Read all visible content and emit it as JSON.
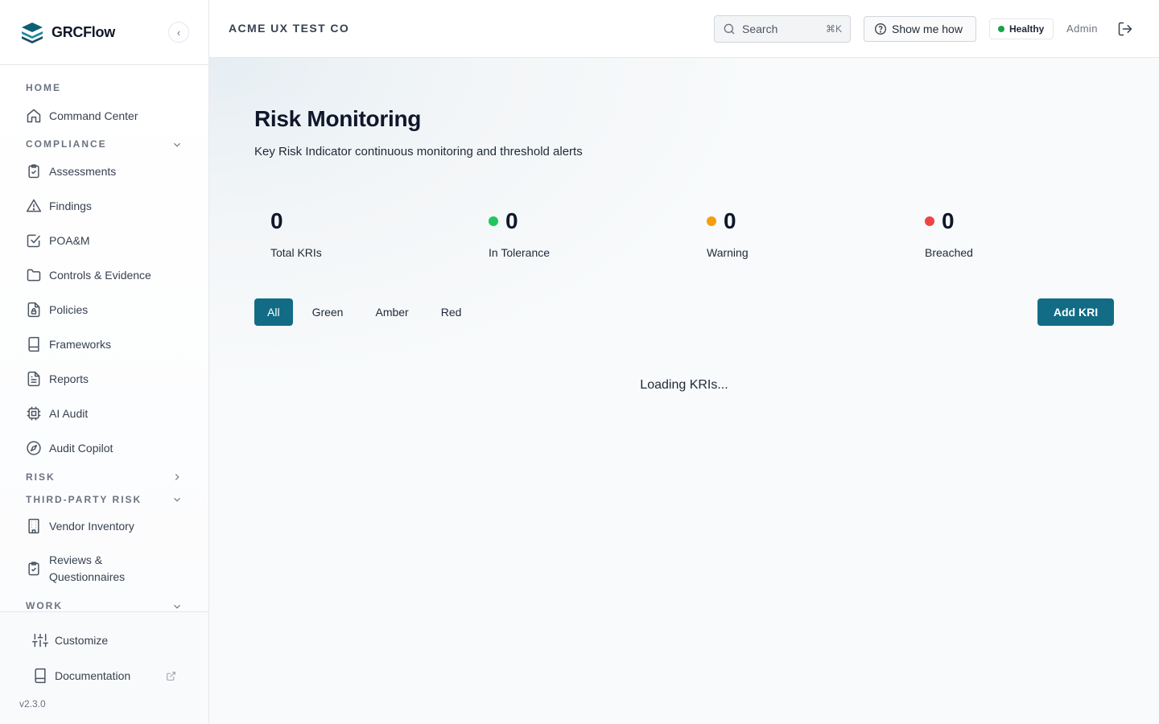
{
  "brand": {
    "name": "GRCFlow",
    "collapse_glyph": "‹"
  },
  "sidebar": {
    "sections": [
      {
        "title": "HOME",
        "chevron": ""
      },
      {
        "title": "COMPLIANCE",
        "chevron": "down"
      },
      {
        "title": "RISK",
        "chevron": "right"
      },
      {
        "title": "THIRD-PARTY RISK",
        "chevron": "down"
      },
      {
        "title": "WORK",
        "chevron": "down"
      }
    ],
    "items": [
      {
        "label": "Command Center",
        "icon": "home-icon"
      },
      {
        "label": "Assessments",
        "icon": "clipboard-check-icon"
      },
      {
        "label": "Findings",
        "icon": "alert-triangle-icon"
      },
      {
        "label": "POA&M",
        "icon": "checkbox-icon"
      },
      {
        "label": "Controls & Evidence",
        "icon": "folder-icon"
      },
      {
        "label": "Policies",
        "icon": "file-lock-icon"
      },
      {
        "label": "Frameworks",
        "icon": "book-icon"
      },
      {
        "label": "Reports",
        "icon": "file-text-icon"
      },
      {
        "label": "AI Audit",
        "icon": "cpu-icon"
      },
      {
        "label": "Audit Copilot",
        "icon": "compass-icon"
      },
      {
        "label": "Vendor Inventory",
        "icon": "building-icon"
      },
      {
        "label_line1": "Reviews &",
        "label_line2": "Questionnaires",
        "icon": "clipboard-check-icon"
      }
    ],
    "footer": {
      "customize": "Customize",
      "documentation": "Documentation",
      "version": "v2.3.0"
    }
  },
  "header": {
    "org": "ACME UX TEST CO",
    "search_placeholder": "Search",
    "search_shortcut": "⌘K",
    "help_label": "Show me how",
    "status": "Healthy",
    "role": "Admin"
  },
  "page": {
    "title": "Risk Monitoring",
    "subtitle": "Key Risk Indicator continuous monitoring and threshold alerts",
    "stats": [
      {
        "value": "0",
        "label": "Total KRIs",
        "dot": ""
      },
      {
        "value": "0",
        "label": "In Tolerance",
        "dot": "#22c55e"
      },
      {
        "value": "0",
        "label": "Warning",
        "dot": "#f59e0b"
      },
      {
        "value": "0",
        "label": "Breached",
        "dot": "#ef4444"
      }
    ],
    "filters": [
      "All",
      "Green",
      "Amber",
      "Red"
    ],
    "active_filter": "All",
    "add_button": "Add KRI",
    "loading": "Loading KRIs..."
  },
  "colors": {
    "accent": "#126c86",
    "healthy": "#16a34a"
  }
}
